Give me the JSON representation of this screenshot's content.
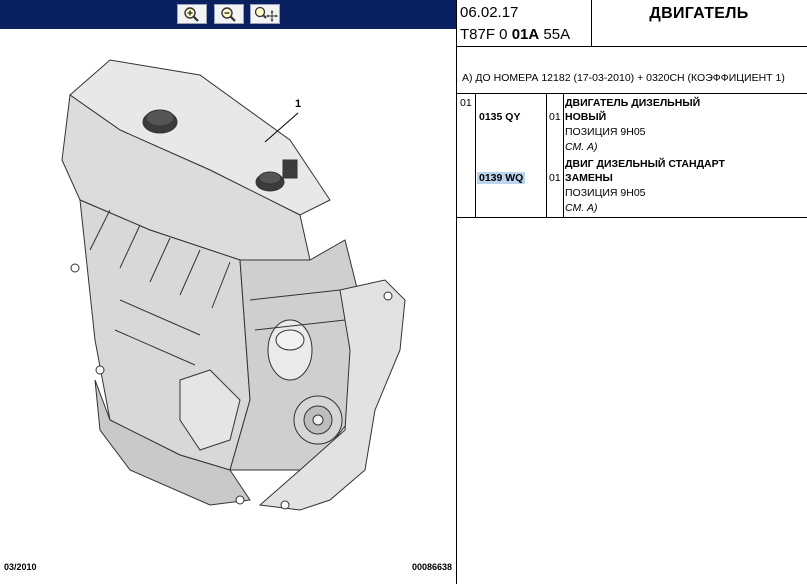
{
  "toolbar": {
    "zoom_in": "zoom-in-icon",
    "zoom_out": "zoom-out-icon",
    "zoom_pan": "zoom-pan-icon"
  },
  "diagram": {
    "callout": "1",
    "footer_date": "03/2010",
    "footer_ref": "00086638"
  },
  "header": {
    "date": "06.02.17",
    "code_prefix": "T87F 0",
    "code_bold": "01A",
    "code_suffix": "55A",
    "title": "ДВИГАТЕЛЬ"
  },
  "note": "А) ДО НОМЕРА 12182 (17-03-2010) + 0320CH (КОЭФФИЦИЕНТ 1)",
  "parts": {
    "index": "01",
    "rows": [
      {
        "ref": "0135 QY",
        "qty": "01",
        "name_line1": "ДВИГАТЕЛЬ ДИЗЕЛЬНЫЙ",
        "name_line2": "НОВЫЙ",
        "position": "ПОЗИЦИЯ 9H05",
        "see": "СМ. А)"
      },
      {
        "ref": "0139 WQ",
        "qty": "01",
        "name_line1": "ДВИГ ДИЗЕЛЬНЫЙ СТАНДАРТ",
        "name_line2": "ЗАМЕНЫ",
        "position": "ПОЗИЦИЯ 9H05",
        "see": "СМ. А)"
      }
    ]
  },
  "colors": {
    "toolbar_bg": "#0a2161",
    "highlight": "#bcd3ee"
  }
}
